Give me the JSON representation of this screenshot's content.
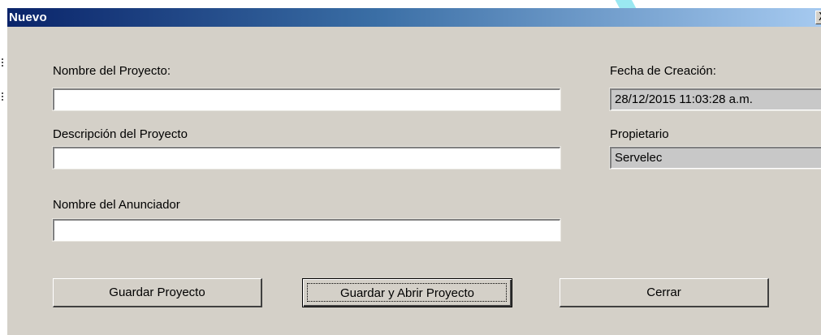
{
  "window": {
    "title": "Nuevo",
    "close_glyph": "X"
  },
  "form": {
    "project_name_label": "Nombre del Proyecto:",
    "project_name_value": "",
    "description_label": "Descripción del Proyecto",
    "description_value": "",
    "advertiser_label": "Nombre del Anunciador",
    "advertiser_value": "",
    "creation_date_label": "Fecha de Creación:",
    "creation_date_value": "28/12/2015 11:03:28 a.m.",
    "owner_label": "Propietario",
    "owner_value": "Servelec"
  },
  "buttons": {
    "save_label": "Guardar Proyecto",
    "save_open_label": "Guardar y Abrir Proyecto",
    "close_label": "Cerrar"
  },
  "colors": {
    "titlebar_start": "#0a246a",
    "titlebar_end": "#a6caf0",
    "window_bg": "#d4d0c8",
    "readonly_bg": "#c8c8c8"
  }
}
